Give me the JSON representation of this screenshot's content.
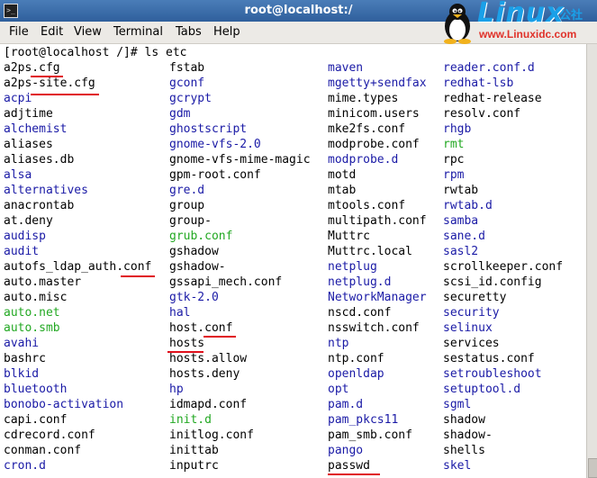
{
  "window": {
    "title": "root@localhost:/"
  },
  "menu": [
    "File",
    "Edit",
    "View",
    "Terminal",
    "Tabs",
    "Help"
  ],
  "logo": {
    "word": "Linux",
    "cn": "公社",
    "url": "www.Linuxidc.com"
  },
  "colors": {
    "black": "#000000",
    "blue": "#1a1aa6",
    "green": "#22a822",
    "underline": "#e0101c"
  },
  "terminal": {
    "prompt": "[root@localhost /]# ls etc",
    "columns": [
      [
        {
          "t": "a2ps.cfg",
          "c": "black"
        },
        {
          "t": "a2ps-site.cfg",
          "c": "black"
        },
        {
          "t": "acpi",
          "c": "blue"
        },
        {
          "t": "adjtime",
          "c": "black"
        },
        {
          "t": "alchemist",
          "c": "blue"
        },
        {
          "t": "aliases",
          "c": "black"
        },
        {
          "t": "aliases.db",
          "c": "black"
        },
        {
          "t": "alsa",
          "c": "blue"
        },
        {
          "t": "alternatives",
          "c": "blue"
        },
        {
          "t": "anacrontab",
          "c": "black"
        },
        {
          "t": "at.deny",
          "c": "black"
        },
        {
          "t": "audisp",
          "c": "blue"
        },
        {
          "t": "audit",
          "c": "blue"
        },
        {
          "t": "autofs_ldap_auth.conf",
          "c": "black"
        },
        {
          "t": "auto.master",
          "c": "black"
        },
        {
          "t": "auto.misc",
          "c": "black"
        },
        {
          "t": "auto.net",
          "c": "green"
        },
        {
          "t": "auto.smb",
          "c": "green"
        },
        {
          "t": "avahi",
          "c": "blue"
        },
        {
          "t": "bashrc",
          "c": "black"
        },
        {
          "t": "blkid",
          "c": "blue"
        },
        {
          "t": "bluetooth",
          "c": "blue"
        },
        {
          "t": "bonobo-activation",
          "c": "blue"
        },
        {
          "t": "capi.conf",
          "c": "black"
        },
        {
          "t": "cdrecord.conf",
          "c": "black"
        },
        {
          "t": "conman.conf",
          "c": "black"
        },
        {
          "t": "cron.d",
          "c": "blue"
        }
      ],
      [
        {
          "t": "fstab",
          "c": "black"
        },
        {
          "t": "gconf",
          "c": "blue"
        },
        {
          "t": "gcrypt",
          "c": "blue"
        },
        {
          "t": "gdm",
          "c": "blue"
        },
        {
          "t": "ghostscript",
          "c": "blue"
        },
        {
          "t": "gnome-vfs-2.0",
          "c": "blue"
        },
        {
          "t": "gnome-vfs-mime-magic",
          "c": "black"
        },
        {
          "t": "gpm-root.conf",
          "c": "black"
        },
        {
          "t": "gre.d",
          "c": "blue"
        },
        {
          "t": "group",
          "c": "black"
        },
        {
          "t": "group-",
          "c": "black"
        },
        {
          "t": "grub.conf",
          "c": "green"
        },
        {
          "t": "gshadow",
          "c": "black"
        },
        {
          "t": "gshadow-",
          "c": "black"
        },
        {
          "t": "gssapi_mech.conf",
          "c": "black"
        },
        {
          "t": "gtk-2.0",
          "c": "blue"
        },
        {
          "t": "hal",
          "c": "blue"
        },
        {
          "t": "host.conf",
          "c": "black"
        },
        {
          "t": "hosts",
          "c": "black"
        },
        {
          "t": "hosts.allow",
          "c": "black"
        },
        {
          "t": "hosts.deny",
          "c": "black"
        },
        {
          "t": "hp",
          "c": "blue"
        },
        {
          "t": "idmapd.conf",
          "c": "black"
        },
        {
          "t": "init.d",
          "c": "green"
        },
        {
          "t": "initlog.conf",
          "c": "black"
        },
        {
          "t": "inittab",
          "c": "black"
        },
        {
          "t": "inputrc",
          "c": "black"
        }
      ],
      [
        {
          "t": "maven",
          "c": "blue"
        },
        {
          "t": "mgetty+sendfax",
          "c": "blue"
        },
        {
          "t": "mime.types",
          "c": "black"
        },
        {
          "t": "minicom.users",
          "c": "black"
        },
        {
          "t": "mke2fs.conf",
          "c": "black"
        },
        {
          "t": "modprobe.conf",
          "c": "black"
        },
        {
          "t": "modprobe.d",
          "c": "blue"
        },
        {
          "t": "motd",
          "c": "black"
        },
        {
          "t": "mtab",
          "c": "black"
        },
        {
          "t": "mtools.conf",
          "c": "black"
        },
        {
          "t": "multipath.conf",
          "c": "black"
        },
        {
          "t": "Muttrc",
          "c": "black"
        },
        {
          "t": "Muttrc.local",
          "c": "black"
        },
        {
          "t": "netplug",
          "c": "blue"
        },
        {
          "t": "netplug.d",
          "c": "blue"
        },
        {
          "t": "NetworkManager",
          "c": "blue"
        },
        {
          "t": "nscd.conf",
          "c": "black"
        },
        {
          "t": "nsswitch.conf",
          "c": "black"
        },
        {
          "t": "ntp",
          "c": "blue"
        },
        {
          "t": "ntp.conf",
          "c": "black"
        },
        {
          "t": "openldap",
          "c": "blue"
        },
        {
          "t": "opt",
          "c": "blue"
        },
        {
          "t": "pam.d",
          "c": "blue"
        },
        {
          "t": "pam_pkcs11",
          "c": "blue"
        },
        {
          "t": "pam_smb.conf",
          "c": "black"
        },
        {
          "t": "pango",
          "c": "blue"
        },
        {
          "t": "passwd",
          "c": "black"
        }
      ],
      [
        {
          "t": "reader.conf.d",
          "c": "blue"
        },
        {
          "t": "redhat-lsb",
          "c": "blue"
        },
        {
          "t": "redhat-release",
          "c": "black"
        },
        {
          "t": "resolv.conf",
          "c": "black"
        },
        {
          "t": "rhgb",
          "c": "blue"
        },
        {
          "t": "rmt",
          "c": "green"
        },
        {
          "t": "rpc",
          "c": "black"
        },
        {
          "t": "rpm",
          "c": "blue"
        },
        {
          "t": "rwtab",
          "c": "black"
        },
        {
          "t": "rwtab.d",
          "c": "blue"
        },
        {
          "t": "samba",
          "c": "blue"
        },
        {
          "t": "sane.d",
          "c": "blue"
        },
        {
          "t": "sasl2",
          "c": "blue"
        },
        {
          "t": "scrollkeeper.conf",
          "c": "black"
        },
        {
          "t": "scsi_id.config",
          "c": "black"
        },
        {
          "t": "securetty",
          "c": "black"
        },
        {
          "t": "security",
          "c": "blue"
        },
        {
          "t": "selinux",
          "c": "blue"
        },
        {
          "t": "services",
          "c": "black"
        },
        {
          "t": "sestatus.conf",
          "c": "black"
        },
        {
          "t": "setroubleshoot",
          "c": "blue"
        },
        {
          "t": "setuptool.d",
          "c": "blue"
        },
        {
          "t": "sgml",
          "c": "blue"
        },
        {
          "t": "shadow",
          "c": "black"
        },
        {
          "t": "shadow-",
          "c": "black"
        },
        {
          "t": "shells",
          "c": "black"
        },
        {
          "t": "skel",
          "c": "blue"
        }
      ]
    ]
  }
}
